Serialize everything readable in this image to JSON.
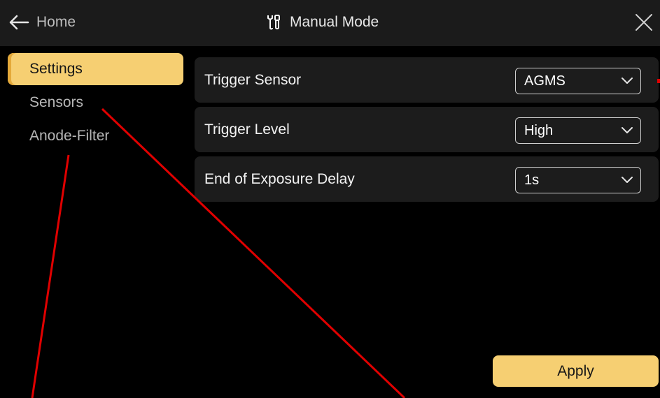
{
  "header": {
    "back_label": "Home",
    "back_icon": "arrow-left-icon",
    "title": "Manual Mode",
    "title_icon": "tools-icon",
    "close_icon": "close-icon"
  },
  "sidebar": {
    "items": [
      {
        "label": "Settings",
        "active": true
      },
      {
        "label": "Sensors",
        "active": false
      },
      {
        "label": "Anode-Filter",
        "active": false
      }
    ]
  },
  "settings": [
    {
      "label": "Trigger Sensor",
      "value": "AGMS"
    },
    {
      "label": "Trigger Level",
      "value": "High"
    },
    {
      "label": "End of Exposure Delay",
      "value": "1s"
    }
  ],
  "footer": {
    "apply_label": "Apply"
  },
  "colors": {
    "accent": "#f6cf72",
    "accent_edge": "#e4a93a",
    "background": "#000000",
    "titlebar": "#1b1b1b",
    "row_background": "#1c1c1c",
    "annotation_line": "#e00000"
  }
}
